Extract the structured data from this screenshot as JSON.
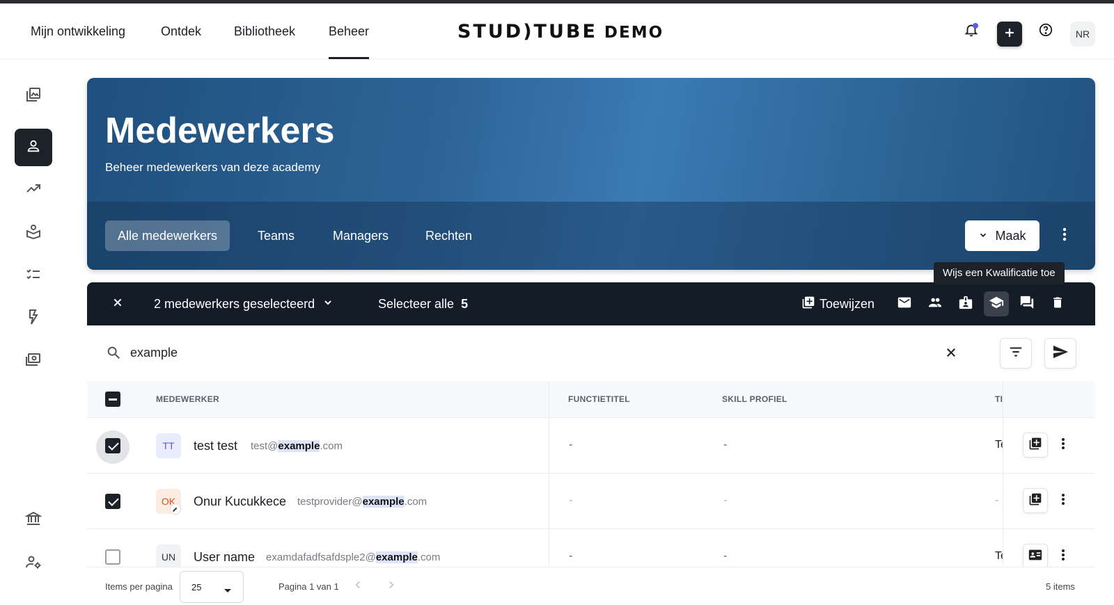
{
  "topnav": {
    "items": [
      "Mijn ontwikkeling",
      "Ontdek",
      "Bibliotheek",
      "Beheer"
    ],
    "active": "Beheer",
    "logo": "STUD)TUBE",
    "logo_demo": "DEMO",
    "user_initials": "NR"
  },
  "sidebar": {
    "icons": [
      "gallery-icon",
      "person-icon",
      "trending-icon",
      "learning-icon",
      "checklist-icon",
      "bolt-icon",
      "money-icon",
      "institution-icon",
      "user-settings-icon"
    ],
    "active": "person-icon"
  },
  "hero": {
    "title": "Medewerkers",
    "subtitle": "Beheer medewerkers van deze academy",
    "tabs": [
      "Alle medewerkers",
      "Teams",
      "Managers",
      "Rechten"
    ],
    "active_tab": "Alle medewerkers",
    "create_label": "Maak"
  },
  "tooltip": "Wijs een Kwalificatie toe",
  "selection_bar": {
    "selected_label": "2 medewerkers geselecteerd",
    "select_all_label": "Selecteer alle",
    "select_all_count": "5",
    "assign_label": "Toewijzen"
  },
  "search": {
    "value": "example"
  },
  "table": {
    "headers": [
      "MEDEWERKER",
      "FUNCTIETITEL",
      "SKILL PROFIEL",
      "TI"
    ],
    "rows": [
      {
        "initials": "TT",
        "name": "test test",
        "email_pre": "test@",
        "email_match": "example",
        "email_post": ".com",
        "functietitel": "-",
        "skill": "-",
        "trunc": "Te",
        "checked": true
      },
      {
        "initials": "OK",
        "name": "Onur Kucukkece",
        "email_pre": "testprovider@",
        "email_match": "example",
        "email_post": ".com",
        "functietitel": "-",
        "skill": "-",
        "trunc": "-",
        "checked": true
      },
      {
        "initials": "UN",
        "name": "User name",
        "email_pre": "examdafadfsafdsple2@",
        "email_match": "example",
        "email_post": ".com",
        "functietitel": "-",
        "skill": "-",
        "trunc": "Te",
        "checked": false
      }
    ]
  },
  "footer": {
    "items_per_page_label": "Items per pagina",
    "items_per_page": "25",
    "page_label": "Pagina 1 van 1",
    "total_label": "5 items"
  },
  "colors": {
    "dark": "#1d2128",
    "hero_blue": "#2d6497",
    "notification": "#5b5bf0"
  }
}
